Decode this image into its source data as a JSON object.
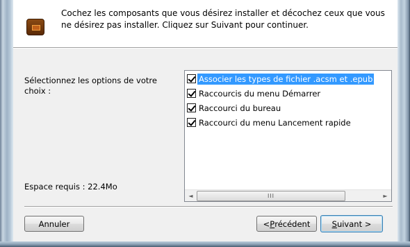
{
  "header": {
    "icon": "package-icon",
    "text": "Cochez les composants que vous désirez installer et décochez ceux que vous ne désirez pas installer. Cliquez sur Suivant pour continuer."
  },
  "options": {
    "label": "Sélectionnez les options de votre choix :",
    "space_required": "Espace requis : 22.4Mo"
  },
  "components": [
    {
      "label": "Associer les types de fichier .acsm et .epub",
      "checked": true,
      "selected": true
    },
    {
      "label": "Raccourcis du menu Démarrer",
      "checked": true,
      "selected": false
    },
    {
      "label": "Raccourci du bureau",
      "checked": true,
      "selected": false
    },
    {
      "label": "Raccourci du menu Lancement rapide",
      "checked": true,
      "selected": false
    }
  ],
  "scrollbar": {
    "left_arrow": "◄",
    "right_arrow": "►",
    "grip": "III"
  },
  "buttons": {
    "cancel": "Annuler",
    "prev_prefix": "< ",
    "prev_mnemonic": "P",
    "prev_rest": "récédent",
    "next_mnemonic": "S",
    "next_rest": "uivant >"
  },
  "colors": {
    "selection": "#3399ff",
    "default_button_border": "#3c7fb1"
  }
}
